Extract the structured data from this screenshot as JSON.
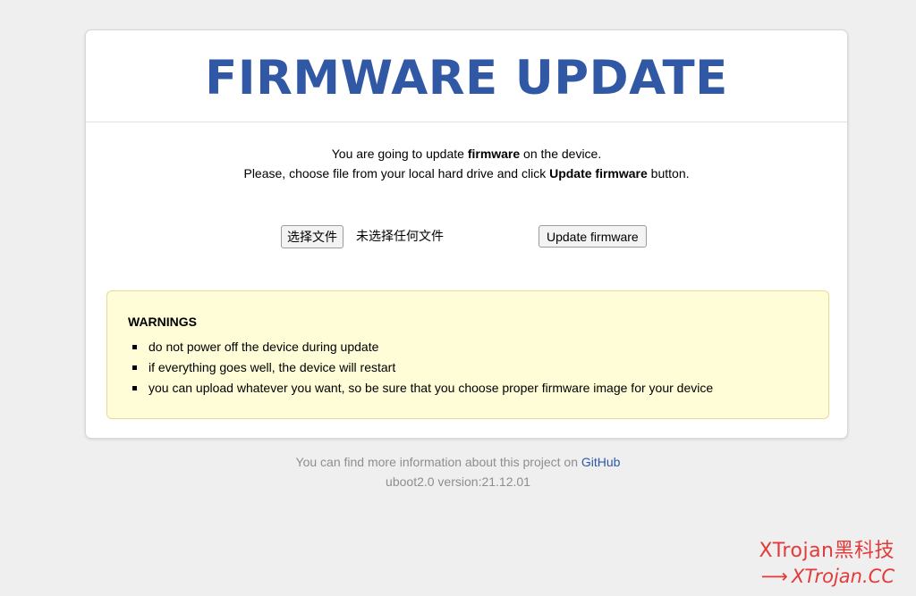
{
  "header": {
    "title": "FIRMWARE UPDATE"
  },
  "intro": {
    "line1_pre": "You are going to update ",
    "line1_bold": "firmware",
    "line1_post": " on the device.",
    "line2_pre": "Please, choose file from your local hard drive and click ",
    "line2_bold": "Update firmware",
    "line2_post": " button."
  },
  "upload": {
    "choose_file_label": "选择文件",
    "no_file_text": "未选择任何文件",
    "update_button_label": "Update firmware"
  },
  "warnings": {
    "title": "WARNINGS",
    "items": [
      "do not power off the device during update",
      "if everything goes well, the device will restart",
      "you can upload whatever you want, so be sure that you choose proper firmware image for your device"
    ]
  },
  "footer": {
    "info_text": "You can find more information about this project on ",
    "link_text": "GitHub",
    "version": "uboot2.0 version:21.12.01"
  },
  "watermark": {
    "line1": "XTrojan黑科技",
    "arrow": "⟶",
    "line2": "XTrojan.CC"
  },
  "colors": {
    "title": "#3058a5",
    "warning_bg": "#fffcd8",
    "warning_border": "#e6dc90",
    "link": "#2e58a3",
    "watermark": "#e33a3a"
  }
}
